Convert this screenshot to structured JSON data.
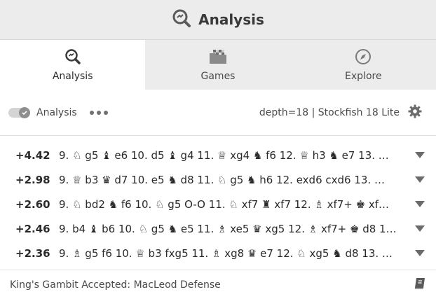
{
  "header": {
    "title": "Analysis",
    "icon": "magnifier-analysis-icon"
  },
  "tabs": [
    {
      "label": "Analysis",
      "icon": "magnifier-analysis-icon",
      "active": true
    },
    {
      "label": "Games",
      "icon": "folder-chessboard-icon",
      "active": false
    },
    {
      "label": "Explore",
      "icon": "compass-icon",
      "active": false
    }
  ],
  "controls": {
    "toggle_on": true,
    "analysis_label": "Analysis",
    "more_icon": "more-dots-icon",
    "engine_info": "depth=18 | Stockfish 18 Lite",
    "settings_icon": "gear-icon"
  },
  "lines": [
    {
      "eval": "+4.42",
      "moves": "9. ♘ g5 ♝ e6 10. d5 ♝ g4 11. ♕ xg4 ♞ f6 12. ♕ h3 ♞ e7 13. …"
    },
    {
      "eval": "+2.98",
      "moves": "9. ♕ b3 ♛ d7 10. e5 ♞ d8 11. ♘ g5 ♞ h6 12. exd6 cxd6 13. …"
    },
    {
      "eval": "+2.60",
      "moves": "9. ♘ bd2 ♞ f6 10. ♘ g5 O-O 11. ♘ xf7 ♜ xf7 12. ♗ xf7+ ♚ xf…"
    },
    {
      "eval": "+2.46",
      "moves": "9. b4 ♝ b6 10. ♘ g5 ♞ e5 11. ♗ xe5 ♛ xg5 12. ♗ xf7+ ♚ d8 1…"
    },
    {
      "eval": "+2.36",
      "moves": "9. ♗ g5 f6 10. ♕ b3 fxg5 11. ♗ xg8 ♛ e7 12. ♘ xg5 ♞ d8 13. …"
    }
  ],
  "footer": {
    "opening": "King's Gambit Accepted: MacLeod Defense",
    "icon": "book-icon"
  },
  "colors": {
    "header_bg": "#ececec",
    "active_tab_bg": "#ffffff",
    "icon": "#6b6b6b"
  }
}
